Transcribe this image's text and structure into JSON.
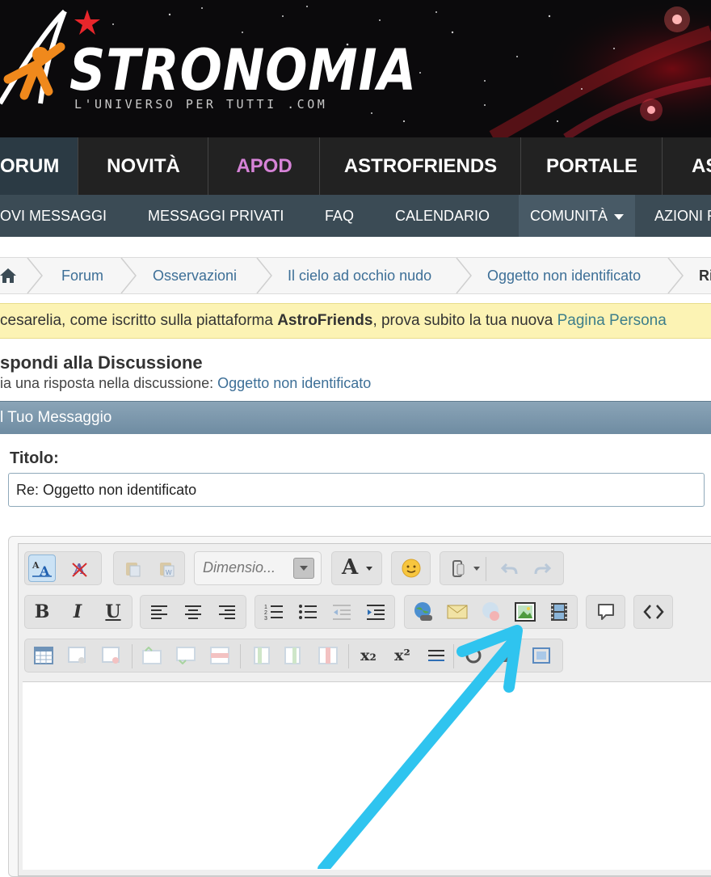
{
  "brand": {
    "name": "STRONOMIA",
    "tagline": "L'UNIVERSO PER TUTTI .COM"
  },
  "nav_primary": [
    "ORUM",
    "NOVITÀ",
    "APOD",
    "ASTROFRIENDS",
    "PORTALE",
    "AS"
  ],
  "nav_secondary": [
    "OVI MESSAGGI",
    "MESSAGGI PRIVATI",
    "FAQ",
    "CALENDARIO",
    "COMUNITÀ",
    "AZIONI F"
  ],
  "breadcrumb": [
    "Forum",
    "Osservazioni",
    "Il cielo ad occhio nudo",
    "Oggetto non identificato",
    "Ri"
  ],
  "notice": {
    "prefix": "cesarelia, come iscritto sulla piattaforma ",
    "bold": "AstroFriends",
    "middle": ", prova subito la tua nuova ",
    "link": "Pagina Persona"
  },
  "page": {
    "title": "spondi alla Discussione",
    "subtitle_prefix": "ia una risposta nella discussione: ",
    "subtitle_link": "Oggetto non identificato",
    "section_bar": "l Tuo Messaggio"
  },
  "form": {
    "title_label": "Titolo:",
    "title_value": "Re: Oggetto non identificato"
  },
  "editor": {
    "font_size_placeholder": "Dimensio...",
    "font_color_label": "A",
    "bold": "B",
    "italic": "I",
    "underline": "U",
    "subscript": "x₂",
    "superscript": "x²"
  },
  "colors": {
    "nav_bg": "#222222",
    "nav_active": "#2b3a44",
    "apod": "#d683d7",
    "arrow": "#2fc4ef",
    "notice_bg": "#fcf3b4"
  }
}
